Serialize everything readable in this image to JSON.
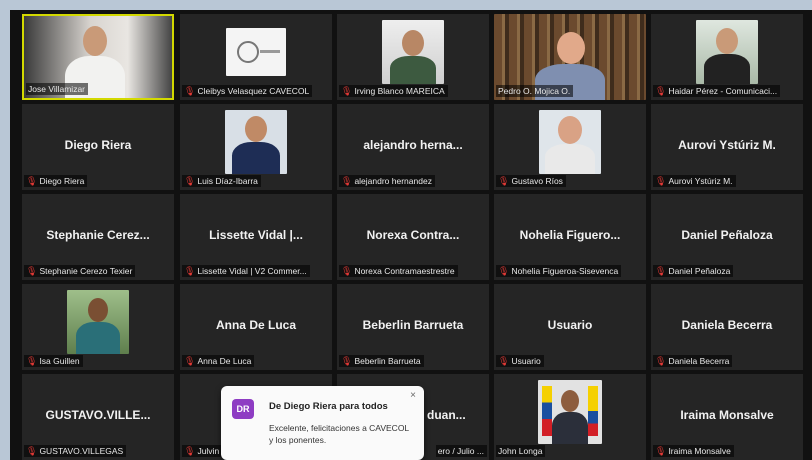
{
  "participants": [
    {
      "label": "Jose Villamizar",
      "big_name": ""
    },
    {
      "label": "Cleibys Velasquez CAVECOL",
      "big_name": ""
    },
    {
      "label": "Irving Blanco MAREICA",
      "big_name": ""
    },
    {
      "label": "Pedro O. Mojica O.",
      "big_name": ""
    },
    {
      "label": "Haidar Pérez - Comunicaci...",
      "big_name": ""
    },
    {
      "label": "Diego Riera",
      "big_name": "Diego Riera"
    },
    {
      "label": "Luis Díaz-Ibarra",
      "big_name": ""
    },
    {
      "label": "alejandro hernandez",
      "big_name": "alejandro hernа..."
    },
    {
      "label": "Gustavo Ríos",
      "big_name": ""
    },
    {
      "label": "Aurovi Ystúriz M.",
      "big_name": "Aurovi Ystúriz M."
    },
    {
      "label": "Stephanie Cerezo Texier",
      "big_name": "Stephanie Cerez..."
    },
    {
      "label": "Lissette Vidal | V2 Commer...",
      "big_name": "Lissette Vidal |..."
    },
    {
      "label": "Norexa Contramaestrestre",
      "big_name": "Norexa Contra..."
    },
    {
      "label": "Nohelia Figueroa-Sisevenca",
      "big_name": "Nohelia Figuero..."
    },
    {
      "label": "Daniel Peñaloza",
      "big_name": "Daniel Peñaloza"
    },
    {
      "label": "Isa Guillen",
      "big_name": ""
    },
    {
      "label": "Anna De Luca",
      "big_name": "Anna De Luca"
    },
    {
      "label": "Beberlin Barrueta",
      "big_name": "Beberlin Barrueta"
    },
    {
      "label": "Usuario",
      "big_name": "Usuario"
    },
    {
      "label": "Daniela Becerra",
      "big_name": "Daniela Becerra"
    },
    {
      "label": "GUSTAVO.VILLEGAS",
      "big_name": "GUSTAVO.VILLE..."
    },
    {
      "label": "Julvin",
      "big_name": ""
    },
    {
      "label": "ero / Julio ...",
      "big_name": "duan..."
    },
    {
      "label": "John Longa",
      "big_name": ""
    },
    {
      "label": "Iraima Monsalve",
      "big_name": "Iraima Monsalve"
    }
  ],
  "chat_popup": {
    "avatar": "DR",
    "from": "De Diego Riera para todos",
    "message": "Excelente, felicitaciones a CAVECOL y los ponentes.",
    "close": "×"
  },
  "icons": {
    "muted_mic": "mic-muted-icon"
  },
  "colors": {
    "active_speaker_border": "#d3d900",
    "tile_bg": "#252525",
    "muted": "#e53935",
    "chat_avatar": "#8e3cc3"
  }
}
